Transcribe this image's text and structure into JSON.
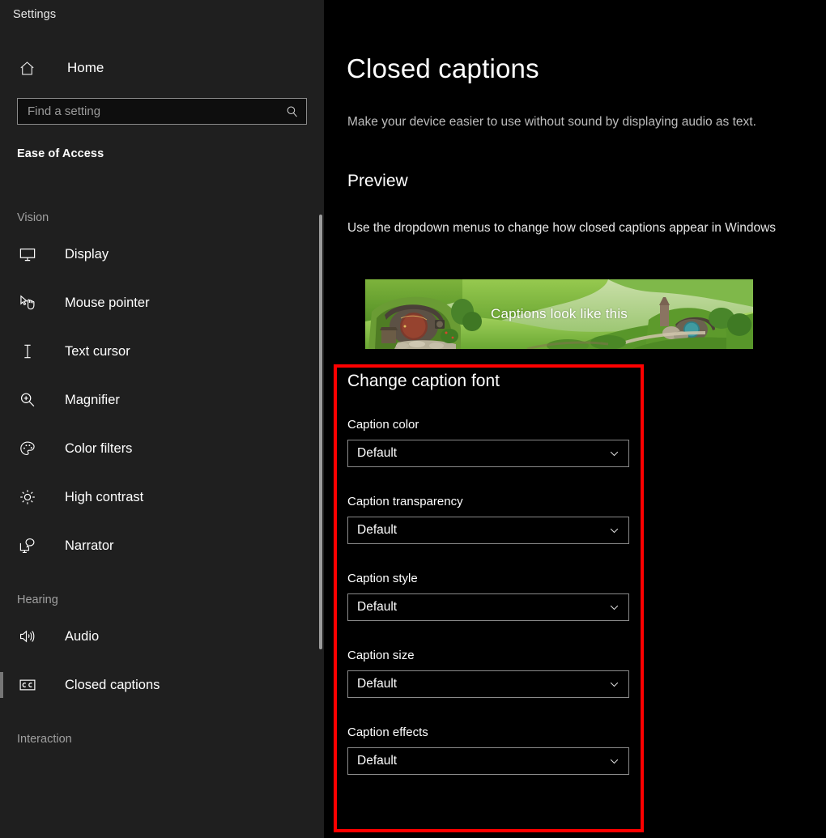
{
  "window": {
    "title": "Settings"
  },
  "sidebar": {
    "home_label": "Home",
    "search": {
      "placeholder": "Find a setting",
      "value": ""
    },
    "category": "Ease of Access",
    "groups": [
      {
        "label": "Vision",
        "items": [
          {
            "label": "Display",
            "icon": "monitor-icon",
            "selected": false
          },
          {
            "label": "Mouse pointer",
            "icon": "mouse-pointer-icon",
            "selected": false
          },
          {
            "label": "Text cursor",
            "icon": "text-cursor-icon",
            "selected": false
          },
          {
            "label": "Magnifier",
            "icon": "magnifier-icon",
            "selected": false
          },
          {
            "label": "Color filters",
            "icon": "palette-icon",
            "selected": false
          },
          {
            "label": "High contrast",
            "icon": "sun-icon",
            "selected": false
          },
          {
            "label": "Narrator",
            "icon": "narrator-icon",
            "selected": false
          }
        ]
      },
      {
        "label": "Hearing",
        "items": [
          {
            "label": "Audio",
            "icon": "speaker-icon",
            "selected": false
          },
          {
            "label": "Closed captions",
            "icon": "closed-caption-icon",
            "selected": true
          }
        ]
      },
      {
        "label": "Interaction",
        "items": []
      }
    ]
  },
  "main": {
    "title": "Closed captions",
    "description": "Make your device easier to use without sound by displaying audio as text.",
    "preview_heading": "Preview",
    "preview_description": "Use the dropdown menus to change how closed captions appear in Windows",
    "preview_caption_text": "Captions look like this",
    "font_section": {
      "heading": "Change caption font",
      "fields": [
        {
          "label": "Caption color",
          "value": "Default"
        },
        {
          "label": "Caption transparency",
          "value": "Default"
        },
        {
          "label": "Caption style",
          "value": "Default"
        },
        {
          "label": "Caption size",
          "value": "Default"
        },
        {
          "label": "Caption effects",
          "value": "Default"
        }
      ]
    }
  },
  "colors": {
    "highlight_box": "#fe0000",
    "sidebar_bg": "#1f1f1f",
    "main_bg": "#000000",
    "selection_bar": "#767676"
  }
}
